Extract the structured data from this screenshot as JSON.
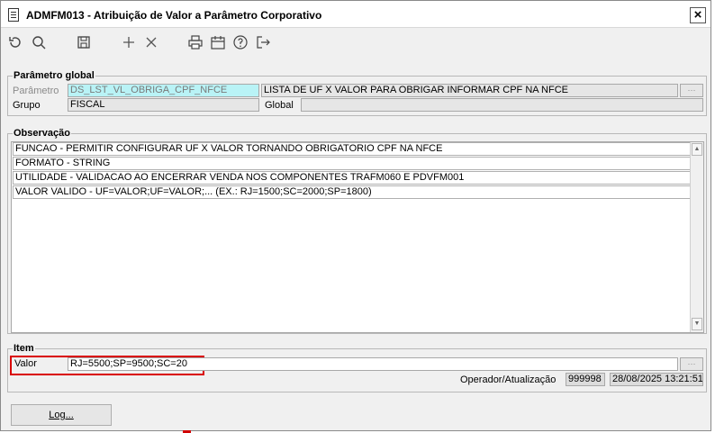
{
  "window": {
    "title": "ADMFM013 - Atribuição de Valor a Parâmetro Corporativo",
    "close_label": "×"
  },
  "toolbar": {
    "icons": [
      "refresh-icon",
      "search-icon",
      "save-icon",
      "add-icon",
      "delete-icon",
      "print-icon",
      "calendar-icon",
      "help-icon",
      "exit-icon"
    ]
  },
  "parametro_global": {
    "group_title": "Parâmetro global",
    "parametro_label": "Parâmetro",
    "parametro_value": "DS_LST_VL_OBRIGA_CPF_NFCE",
    "descricao_value": "LISTA DE UF X VALOR PARA OBRIGAR INFORMAR CPF NA NFCE",
    "grupo_label": "Grupo",
    "grupo_value": "FISCAL",
    "global_label": "Global",
    "global_value": ""
  },
  "observacao": {
    "group_title": "Observação",
    "lines": [
      "FUNCAO - PERMITIR CONFIGURAR UF X VALOR TORNANDO OBRIGATORIO CPF NA NFCE",
      "FORMATO - STRING",
      "UTILIDADE - VALIDACAO AO ENCERRAR VENDA NOS COMPONENTES TRAFM060 E PDVFM001",
      "VALOR VALIDO - UF=VALOR;UF=VALOR;... (EX.: RJ=1500;SC=2000;SP=1800)"
    ]
  },
  "item": {
    "group_title": "Item",
    "valor_label": "Valor",
    "valor_value": "RJ=5500;SP=9500;SC=20",
    "operador_label": "Operador/Atualização",
    "operador_value": "999998",
    "atualizacao_value": "28/08/2025 13:21:51"
  },
  "footer": {
    "log_button_label": "Log..."
  },
  "colors": {
    "highlight": "#d90000",
    "cyan_field": "#b9f3f6"
  }
}
